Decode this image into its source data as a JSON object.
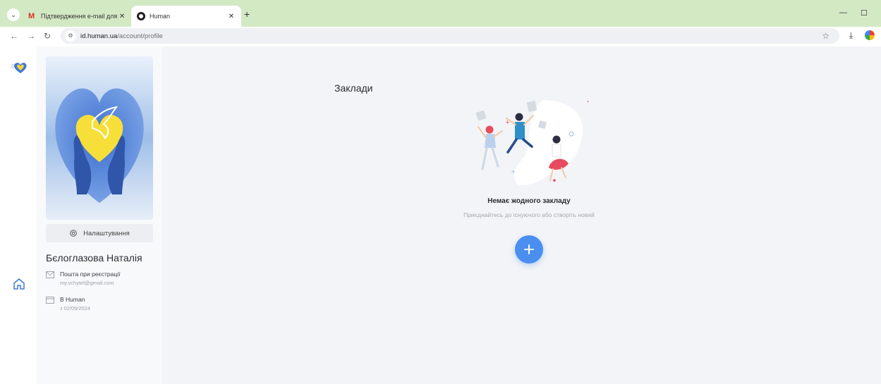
{
  "browser": {
    "tabs": [
      {
        "title": "Підтвердження e-mail для реє",
        "active": false,
        "icon": "gmail-icon"
      },
      {
        "title": "Human",
        "active": true,
        "icon": "human-favicon"
      }
    ],
    "url_host": "id.human.ua",
    "url_path": "/account/profile"
  },
  "profile": {
    "settings_label": "Налаштування",
    "name": "Бєлоглазова Наталія",
    "email_label": "Пошта при реєстрації",
    "email_value": "my.vchytel@gmail.com",
    "since_label": "В Human",
    "since_value": "з 02/09/2024"
  },
  "main": {
    "section_title": "Заклади",
    "empty_title": "Немає жодного закладу",
    "empty_subtitle": "Приєднайтесь до існуючого або створіть новий"
  },
  "colors": {
    "accent": "#4a8ff0",
    "content_bg": "#f2f4f7",
    "tabstrip_bg": "#d3e9c4"
  }
}
